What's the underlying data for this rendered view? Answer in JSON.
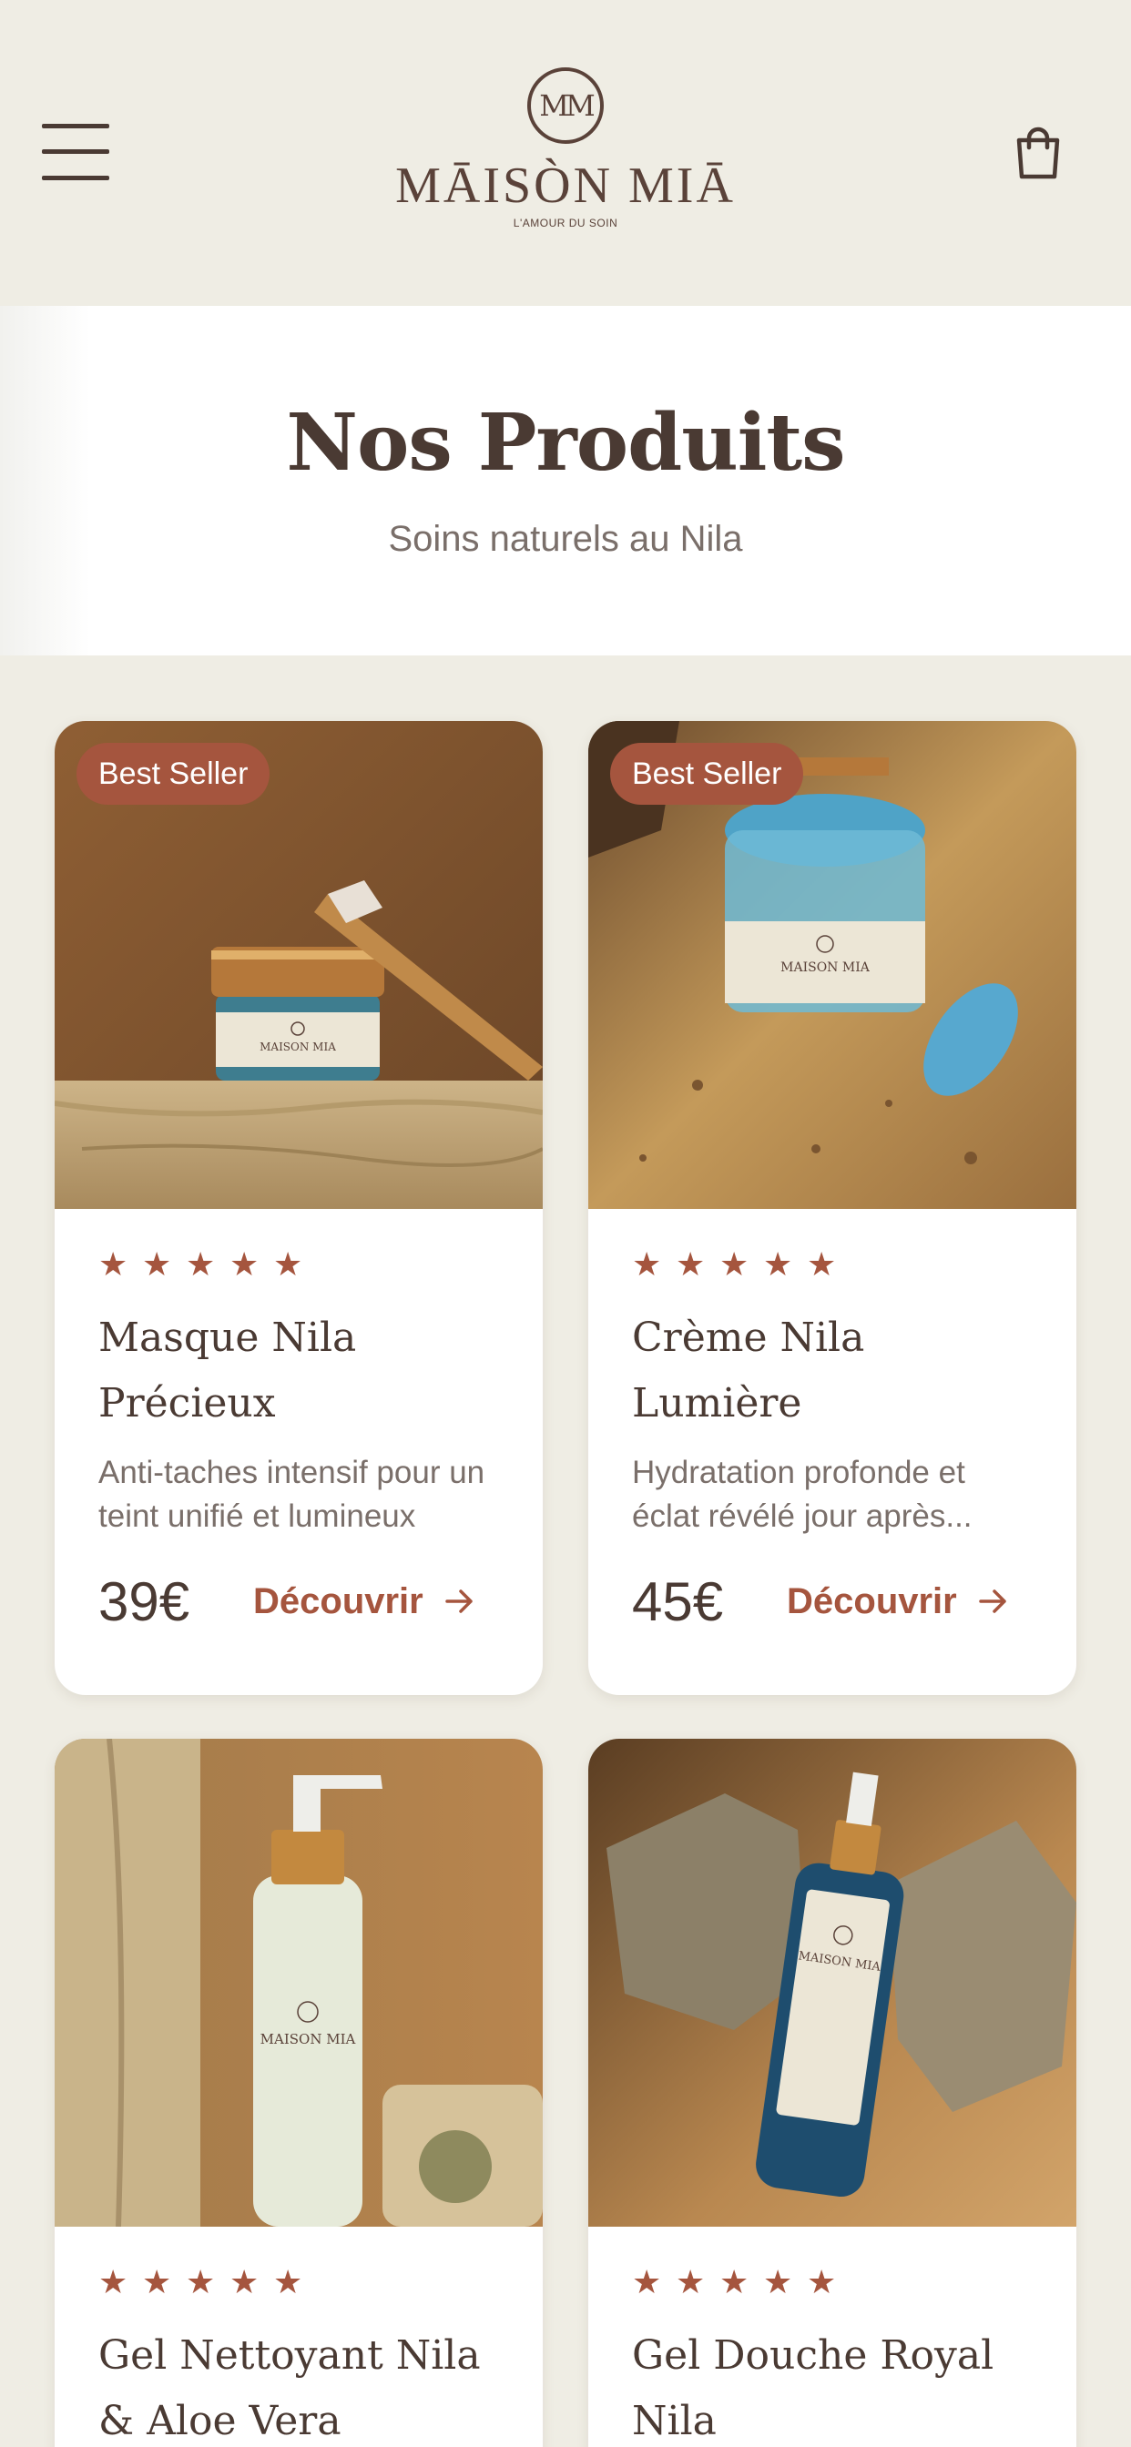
{
  "header": {
    "logo_monogram": "MM",
    "logo_name": "MĀISÒN MIĀ",
    "logo_tagline": "L'AMOUR DU SOIN"
  },
  "hero": {
    "title": "Nos Produits",
    "subtitle": "Soins naturels au Nila"
  },
  "products": [
    {
      "badge": "Best Seller",
      "rating": 5,
      "name": "Masque Nila Précieux",
      "description": "Anti-taches intensif pour un teint unifié et lumineux",
      "price": "39€",
      "cta": "Découvrir"
    },
    {
      "badge": "Best Seller",
      "rating": 5,
      "name": "Crème Nila Lumière",
      "description": "Hydratation profonde et éclat révélé jour après...",
      "price": "45€",
      "cta": "Découvrir"
    },
    {
      "rating": 5,
      "name": "Gel Nettoyant Nila & Aloe Vera"
    },
    {
      "rating": 5,
      "name": "Gel Douche Royal Nila"
    }
  ],
  "icons": {
    "menu": "hamburger-menu-icon",
    "cart": "shopping-bag-icon",
    "star": "star-icon",
    "arrow": "arrow-right-icon"
  },
  "colors": {
    "accent": "#a5553e",
    "text": "#4a3a33",
    "muted": "#7a6f6a",
    "background": "#efede4"
  }
}
